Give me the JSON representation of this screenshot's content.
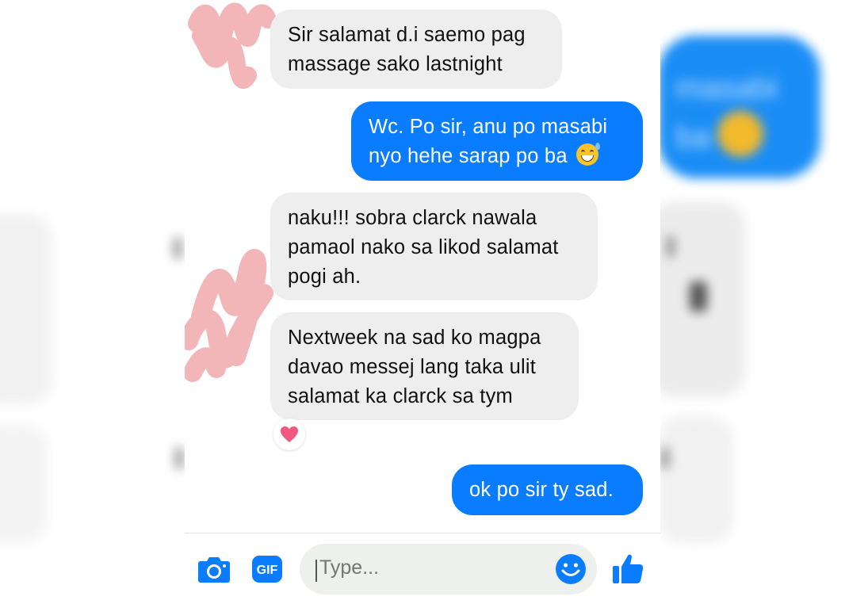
{
  "backdrop": {
    "blurred_text": "masabi\nba"
  },
  "messages": [
    {
      "direction": "incoming",
      "lines": [
        "Sir salamat d.i saemo pag",
        "massage sako lastnight"
      ]
    },
    {
      "direction": "outgoing",
      "lines": [
        "Wc. Po sir, anu po masabi",
        "nyo hehe sarap po ba"
      ],
      "emoji": "grinning-sweat-emoji"
    },
    {
      "direction": "incoming",
      "lines": [
        "naku!!! sobra clarck nawala",
        "pamaol nako sa likod salamat",
        "pogi ah."
      ]
    },
    {
      "direction": "incoming",
      "lines": [
        "Nextweek na sad ko magpa",
        "davao messej lang taka ulit",
        "salamat ka clarck sa tym"
      ],
      "reaction": "heart-icon"
    },
    {
      "direction": "outgoing",
      "lines": [
        "ok po sir ty sad."
      ]
    }
  ],
  "composer": {
    "camera_icon": "camera-icon",
    "gif_label": "GIF",
    "placeholder": "Type...",
    "emoji_icon": "smiley-icon",
    "like_icon": "thumbs-up-icon"
  },
  "colors": {
    "outgoing_bubble": "#0a7cff",
    "incoming_bubble": "#eeeeef",
    "accent": "#0a7cff",
    "reaction_heart": "#f2577e",
    "redaction_scribble": "#f0a9ad"
  }
}
